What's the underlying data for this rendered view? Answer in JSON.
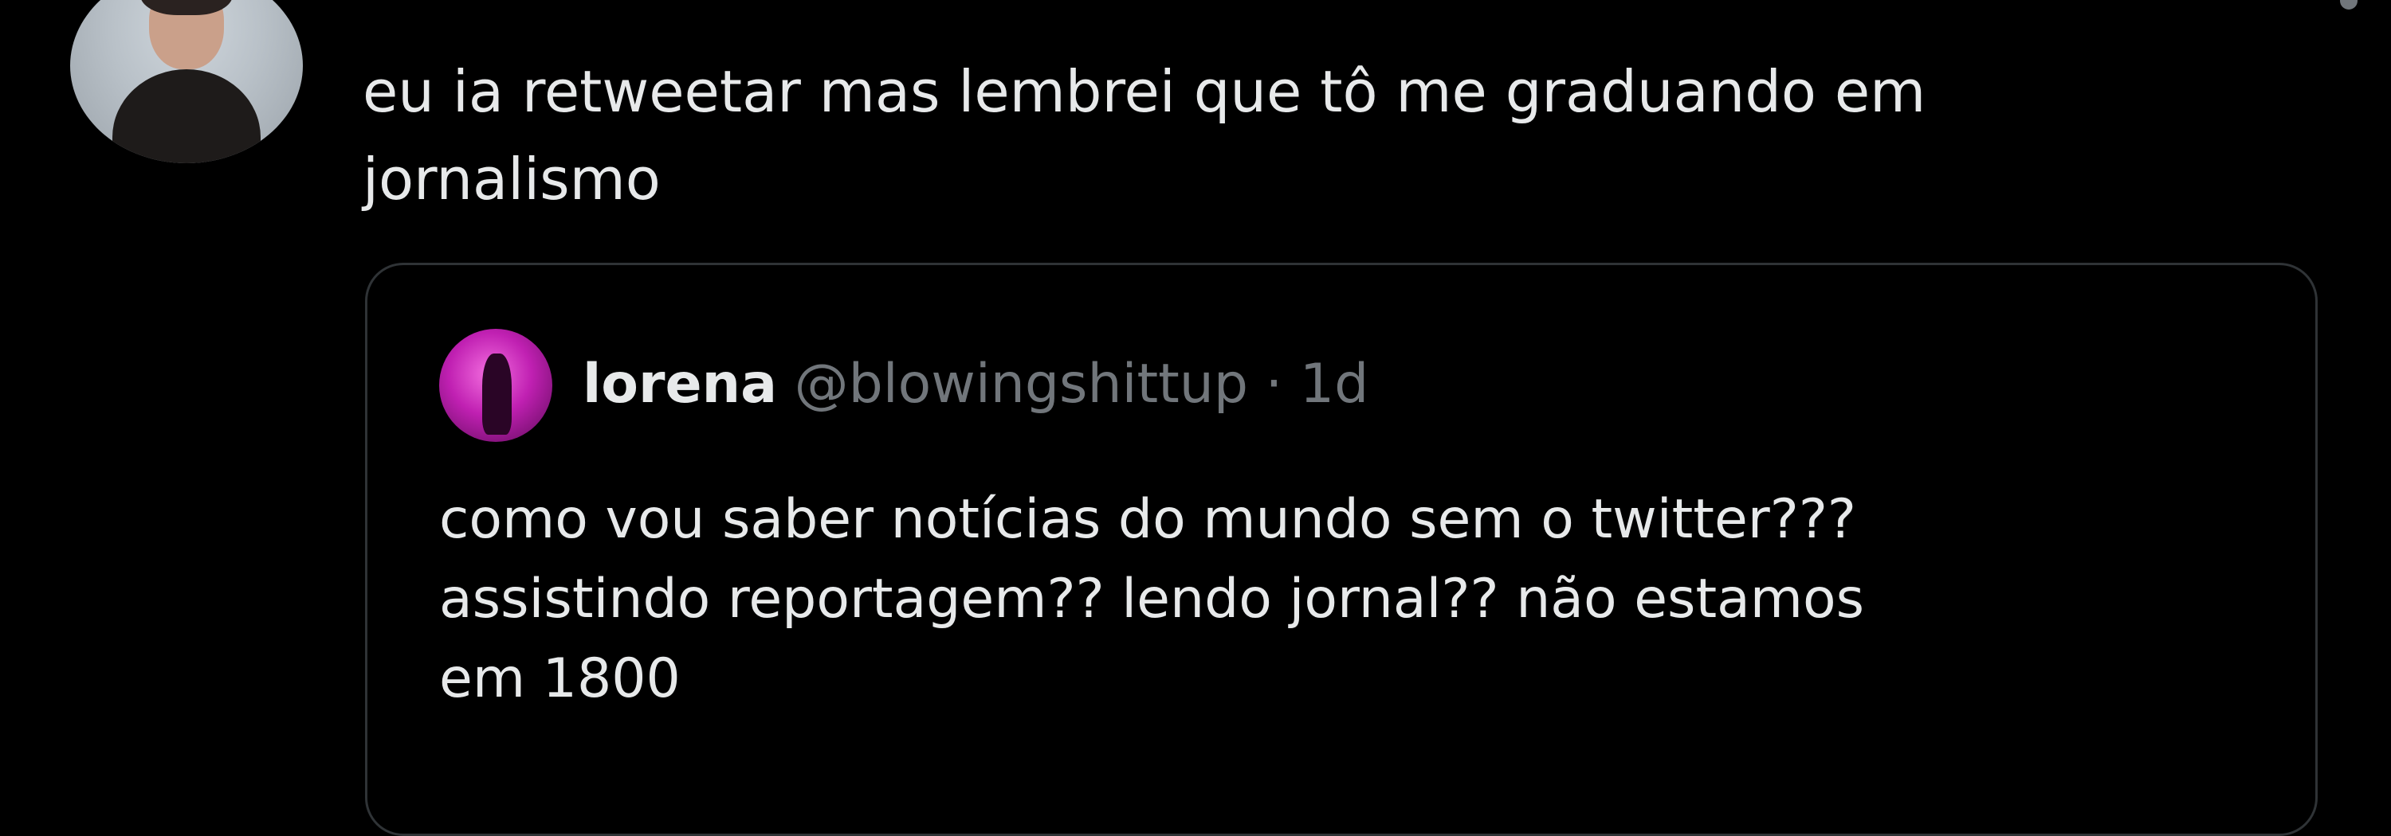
{
  "tweet": {
    "text": "eu ia retweetar mas lembrei que tô me graduando em\njornalismo"
  },
  "quoted_tweet": {
    "display_name": "lorena",
    "handle": "@blowingshittup",
    "separator": "·",
    "time": "1d",
    "text": "como vou saber notícias do mundo sem o twitter???\nassistindo reportagem?? lendo jornal?? não estamos\nem 1800"
  },
  "icons": {
    "more": "more-options-icon"
  },
  "colors": {
    "background": "#000000",
    "text_primary": "#e7e9ea",
    "text_secondary": "#71767b",
    "border": "#2f3336"
  }
}
